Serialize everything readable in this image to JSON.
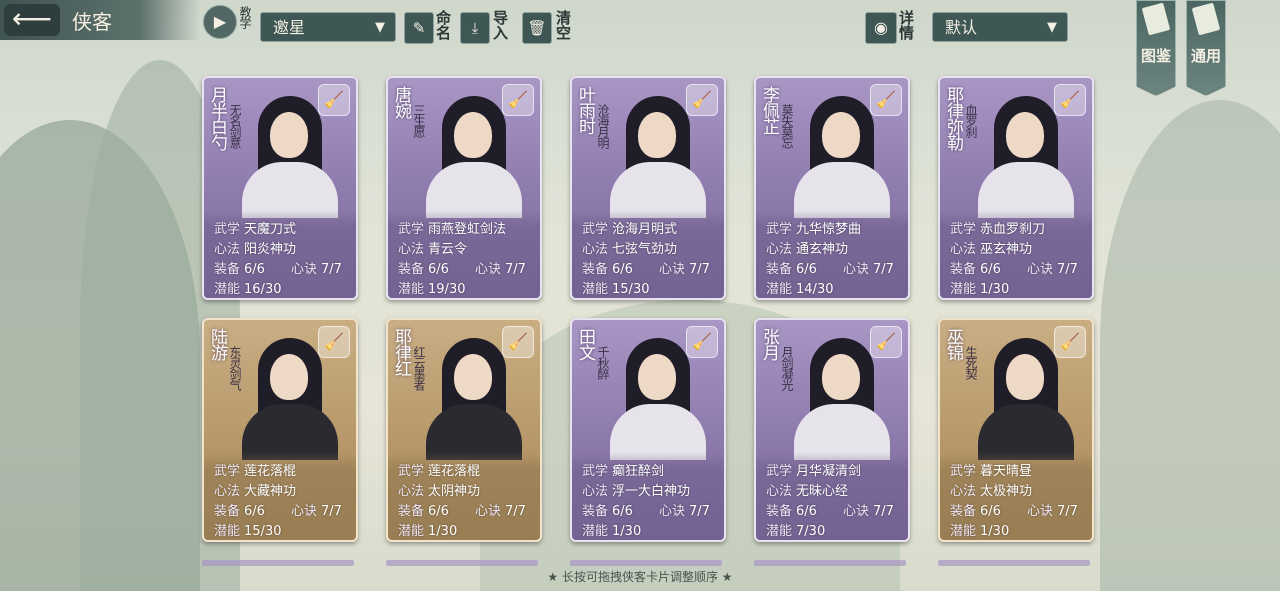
{
  "header": {
    "title": "侠客",
    "back_icon": "back-arrow-icon",
    "tutorial_label": "教学",
    "filter_value": "邀星",
    "rename_label": "命名",
    "import_label": "导入",
    "clear_label": "清空",
    "details_label": "详情",
    "sort_value": "默认",
    "gallery_label": "图鉴",
    "general_label": "通用"
  },
  "labels": {
    "martial": "武学",
    "mind": "心法",
    "equip": "装备",
    "secret": "心诀",
    "potential": "潜能"
  },
  "cards": [
    {
      "name": "月半白勺",
      "epithet": "无名剑意",
      "martial": "天魔刀式",
      "mind": "阳炎神功",
      "equip": "6/6",
      "secret": "7/7",
      "potential": "16/30",
      "rarity": "purple"
    },
    {
      "name": "唐婉",
      "epithet": "三生愿",
      "martial": "雨燕登虹剑法",
      "mind": "青云令",
      "equip": "6/6",
      "secret": "7/7",
      "potential": "19/30",
      "rarity": "purple"
    },
    {
      "name": "叶雨时",
      "epithet": "沧海月明",
      "martial": "沧海月明式",
      "mind": "七弦气劲功",
      "equip": "6/6",
      "secret": "7/7",
      "potential": "15/30",
      "rarity": "purple"
    },
    {
      "name": "李佩芷",
      "epithet": "莫失莫忘",
      "martial": "九华惊梦曲",
      "mind": "通玄神功",
      "equip": "6/6",
      "secret": "7/7",
      "potential": "14/30",
      "rarity": "purple"
    },
    {
      "name": "耶律弥勒",
      "epithet": "血罗刹",
      "martial": "赤血罗刹刀",
      "mind": "巫玄神功",
      "equip": "6/6",
      "secret": "7/7",
      "potential": "1/30",
      "rarity": "purple"
    },
    {
      "name": "陆游",
      "epithet": "东灵剑气",
      "martial": "莲花落棍",
      "mind": "大藏神功",
      "equip": "6/6",
      "secret": "7/7",
      "potential": "15/30",
      "rarity": "gold"
    },
    {
      "name": "耶律红",
      "epithet": "红云墨者",
      "martial": "莲花落棍",
      "mind": "太阴神功",
      "equip": "6/6",
      "secret": "7/7",
      "potential": "1/30",
      "rarity": "gold"
    },
    {
      "name": "田文",
      "epithet": "千秋醉",
      "martial": "癫狂醉剑",
      "mind": "浮一大白神功",
      "equip": "6/6",
      "secret": "7/7",
      "potential": "1/30",
      "rarity": "purple"
    },
    {
      "name": "张月",
      "epithet": "月剑凝光",
      "martial": "月华凝清剑",
      "mind": "无昧心经",
      "equip": "6/6",
      "secret": "7/7",
      "potential": "7/30",
      "rarity": "purple"
    },
    {
      "name": "巫锦",
      "epithet": "生死契",
      "martial": "暮天晴昼",
      "mind": "太极神功",
      "equip": "6/6",
      "secret": "7/7",
      "potential": "1/30",
      "rarity": "gold"
    }
  ],
  "footer": {
    "hint": "★ 长按可拖拽侠客卡片调整顺序 ★"
  },
  "colors": {
    "purple": "#8f7cae",
    "gold": "#b89a6c",
    "toolbar": "#3e5654"
  }
}
